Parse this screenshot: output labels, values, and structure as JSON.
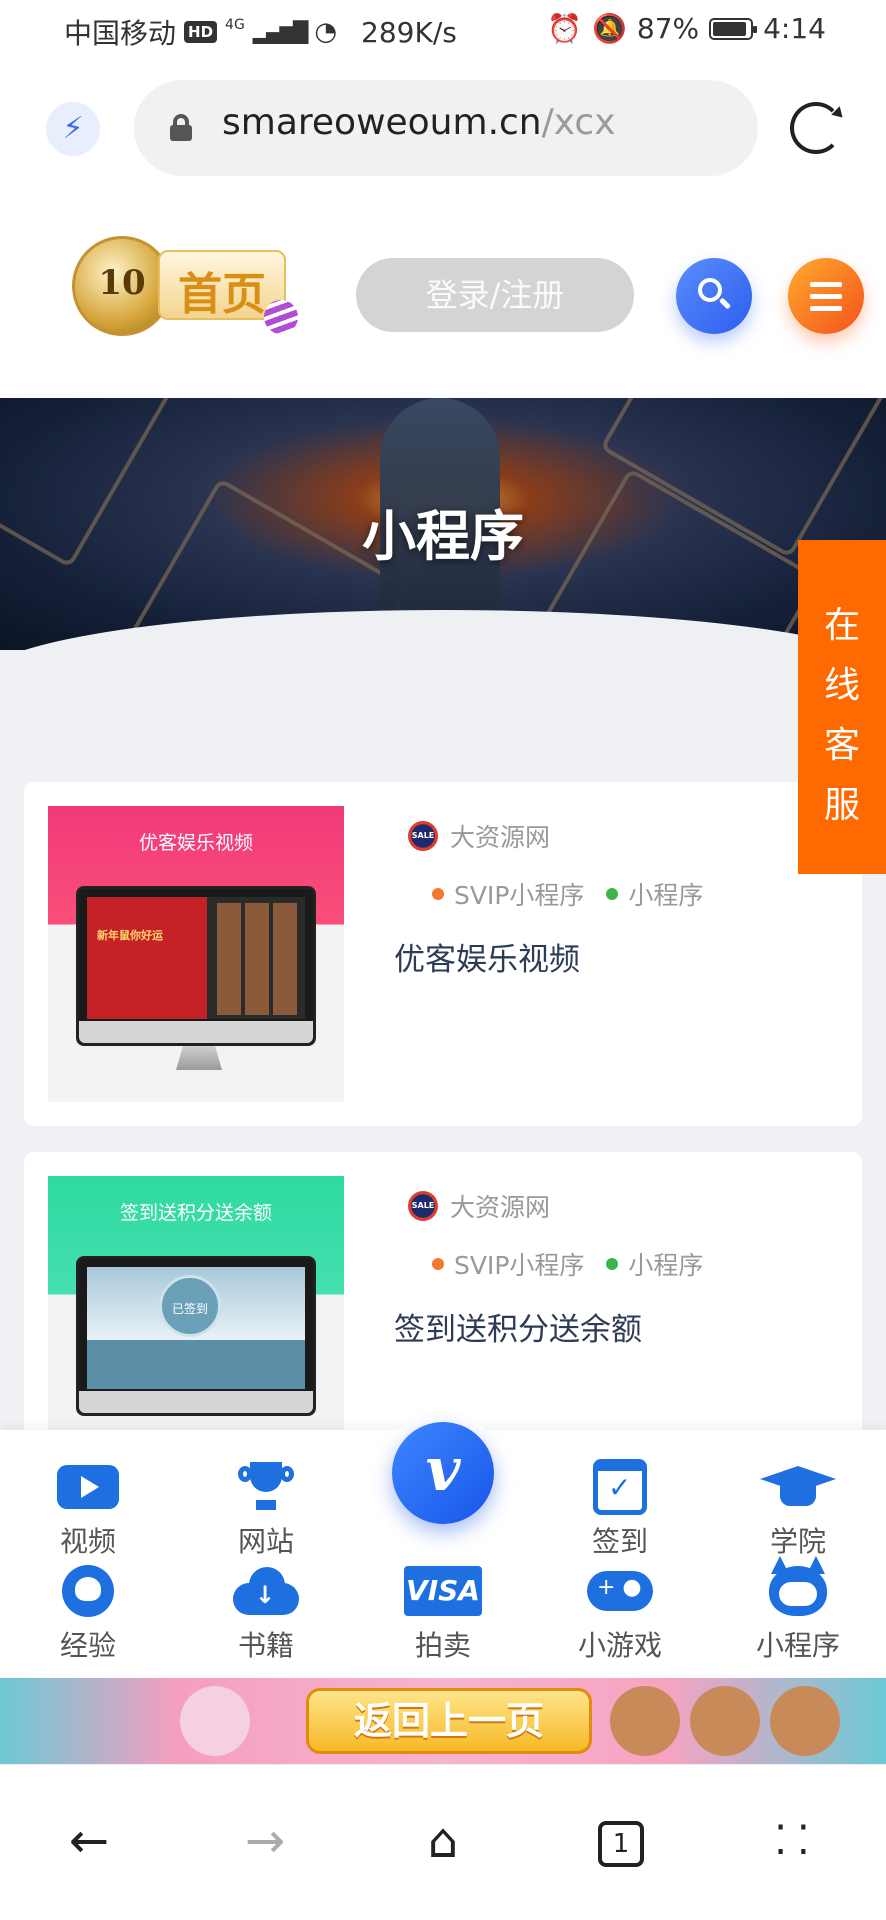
{
  "status_bar": {
    "carrier": "中国移动",
    "hd": "HD",
    "network": "4G",
    "speed": "289K/s",
    "battery": "87%",
    "time": "4:14"
  },
  "browser": {
    "domain": "smareoweoum.cn",
    "path": "/xcx"
  },
  "site_header": {
    "logo_number": "10",
    "logo_home": "首页",
    "login_label": "登录/注册"
  },
  "banner": {
    "title": "小程序"
  },
  "service_tab": {
    "label_chars": [
      "在",
      "线",
      "客",
      "服"
    ]
  },
  "cards": [
    {
      "thumb_title": "优客娱乐视频",
      "thumb_screen_text": "新年鼠你好运",
      "source": "大资源网",
      "source_icon_text": "SALE",
      "tags": [
        {
          "label": "SVIP小程序",
          "color": "#f4782d"
        },
        {
          "label": "小程序",
          "color": "#3bb54a"
        }
      ],
      "name": "优客娱乐视频"
    },
    {
      "thumb_title": "签到送积分送余额",
      "thumb_screen_text": "已签到",
      "source": "大资源网",
      "source_icon_text": "SALE",
      "tags": [
        {
          "label": "SVIP小程序",
          "color": "#f4782d"
        },
        {
          "label": "小程序",
          "color": "#3bb54a"
        }
      ],
      "name": "签到送积分送余额"
    }
  ],
  "nav_grid": {
    "center_glyph": "v",
    "items": [
      {
        "label": "视频",
        "icon": "play-icon"
      },
      {
        "label": "网站",
        "icon": "trophy-icon"
      },
      {
        "label": "签到",
        "icon": "calendar-check-icon"
      },
      {
        "label": "学院",
        "icon": "graduation-cap-icon"
      },
      {
        "label": "经验",
        "icon": "github-icon"
      },
      {
        "label": "书籍",
        "icon": "cloud-download-icon"
      },
      {
        "label": "拍卖",
        "icon": "visa-icon",
        "glyph": "VISA"
      },
      {
        "label": "小游戏",
        "icon": "gamepad-icon"
      },
      {
        "label": "小程序",
        "icon": "cat-icon"
      }
    ]
  },
  "back_banner": {
    "label": "返回上一页"
  },
  "browser_nav": {
    "tab_count": "1"
  },
  "colors": {
    "accent_blue": "#1e6fe0",
    "service_orange": "#ff6a00",
    "title_navy": "#2d3b55"
  }
}
